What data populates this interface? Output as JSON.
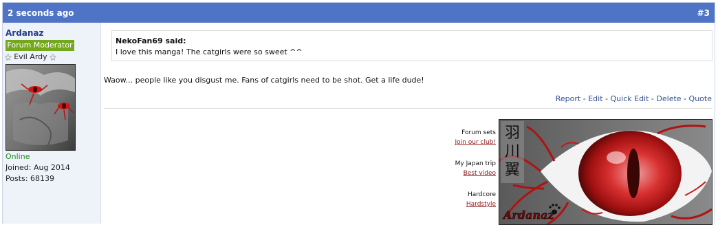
{
  "post": {
    "time": "2 seconds ago",
    "number": "#3"
  },
  "user": {
    "name": "Ardanaz",
    "rank": "Forum Moderator",
    "title": "Evil Ardy",
    "title_ornament": "⚝",
    "status": "Online",
    "joined": "Joined: Aug 2014",
    "posts": "Posts: 68139"
  },
  "quote": {
    "author": "NekoFan69 said:",
    "text": "I love this manga! The catgirls were so sweet ^^"
  },
  "message": "Waow... people like you disgust me. Fans of catgirls need to be shot. Get a life dude!",
  "actions": {
    "items": [
      "Report",
      "Edit",
      "Quick Edit",
      "Delete",
      "Quote"
    ],
    "separator": "-"
  },
  "signature": {
    "links": [
      {
        "label": "Forum sets",
        "link": "Join our club!"
      },
      {
        "label": "My Japan trip",
        "link": "Best video"
      },
      {
        "label": "Hardcore",
        "link": "Hardstyle"
      }
    ],
    "banner_kanji": [
      "羽",
      "川",
      "翼"
    ],
    "banner_signature": "Ardanaz"
  },
  "colors": {
    "header_bg": "#4f74c6",
    "sidebar_bg": "#eef2f9",
    "rank_badge": "#74a81c",
    "online": "#228b22",
    "sig_link": "#8b1a1a",
    "eye_red": "#c8201e"
  }
}
